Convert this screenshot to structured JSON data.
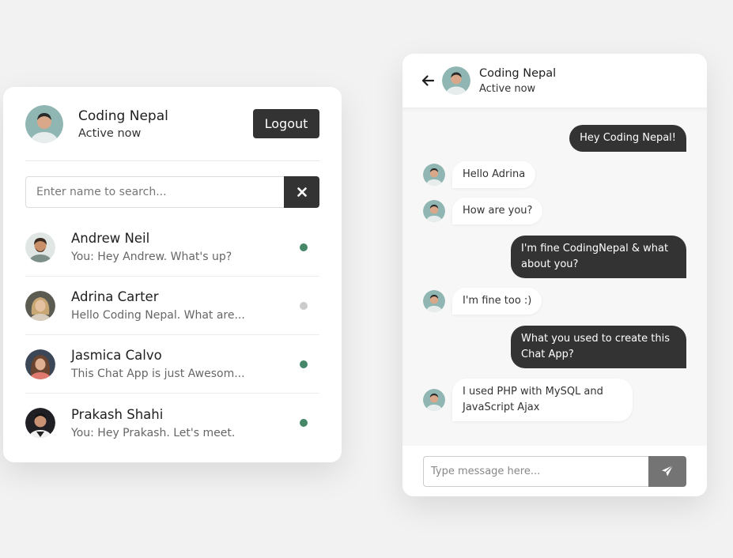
{
  "users_panel": {
    "me": {
      "name": "Coding Nepal",
      "status": "Active now"
    },
    "logout_label": "Logout",
    "search": {
      "placeholder": "Enter name to search...",
      "value": ""
    },
    "users": [
      {
        "name": "Andrew Neil",
        "message": "You: Hey Andrew. What's up?",
        "online": true
      },
      {
        "name": "Adrina Carter",
        "message": "Hello Coding Nepal. What are...",
        "online": false
      },
      {
        "name": "Jasmica Calvo",
        "message": "This Chat App is just Awesom...",
        "online": true
      },
      {
        "name": "Prakash Shahi",
        "message": "You: Hey Prakash. Let's meet.",
        "online": true
      }
    ]
  },
  "chat_panel": {
    "contact": {
      "name": "Coding Nepal",
      "status": "Active now"
    },
    "messages": [
      {
        "dir": "out",
        "text": "Hey Coding Nepal!"
      },
      {
        "dir": "in",
        "text": "Hello Adrina"
      },
      {
        "dir": "in",
        "text": "How are you?"
      },
      {
        "dir": "out",
        "text": "I'm fine CodingNepal & what about you?"
      },
      {
        "dir": "in",
        "text": "I'm fine too :)"
      },
      {
        "dir": "out",
        "text": "What you used to create this Chat App?"
      },
      {
        "dir": "in",
        "text": "I used PHP with MySQL and JavaScript Ajax"
      }
    ],
    "input": {
      "placeholder": "Type message here...",
      "value": ""
    }
  },
  "icons": {
    "search_clear": "close-icon",
    "back": "arrow-left-icon",
    "send": "paper-plane-icon"
  },
  "colors": {
    "dark": "#333333",
    "online": "#468669",
    "offline": "#cccccc",
    "send_button": "#747474"
  }
}
